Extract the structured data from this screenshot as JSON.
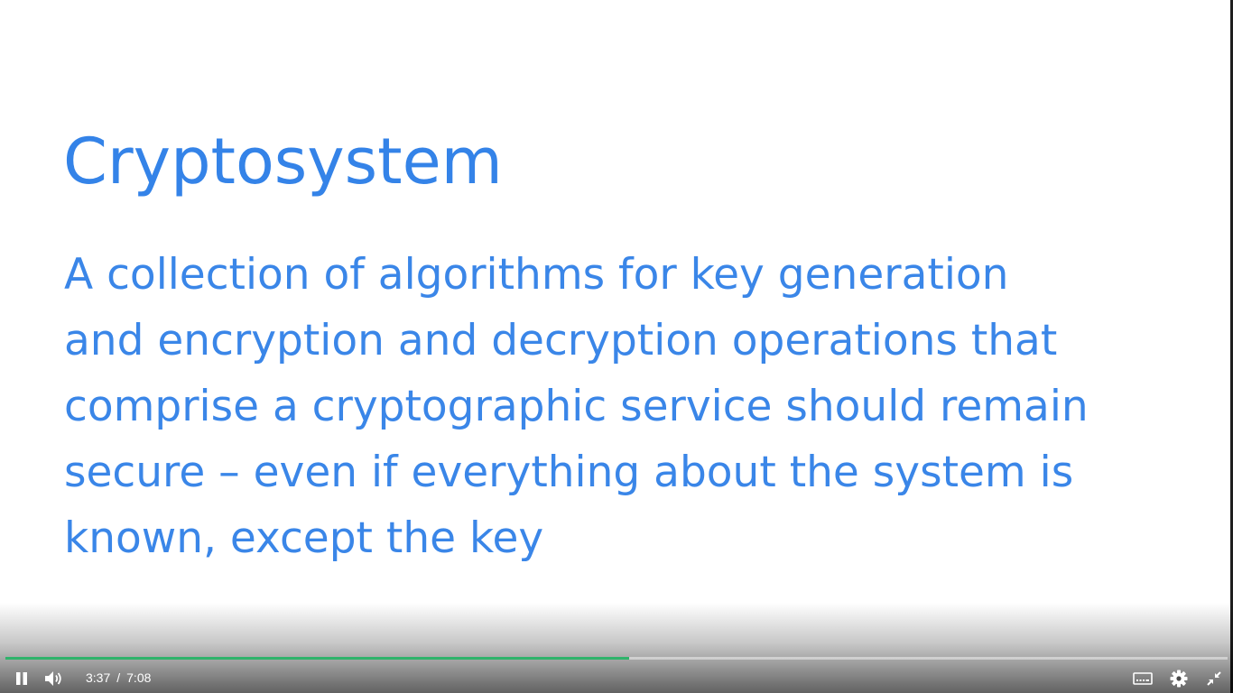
{
  "slide": {
    "title": "Cryptosystem",
    "body_lines": [
      "A collection of algorithms for key generation",
      "and encryption and decryption operations that",
      "comprise a cryptographic service should remain",
      "secure – even if everything about the system is",
      "known, except the key"
    ]
  },
  "player": {
    "current_time": "3:37",
    "time_separator": "/",
    "duration": "7:08",
    "progress_fraction": 0.51,
    "progress_color": "#2fb36b",
    "icons": {
      "play_pause": "pause-icon",
      "volume": "volume-icon",
      "captions": "captions-icon",
      "settings": "gear-icon",
      "fullscreen": "exit-fullscreen-icon"
    }
  },
  "colors": {
    "title": "#3483e8",
    "body": "#3a86e8",
    "background": "#ffffff"
  }
}
